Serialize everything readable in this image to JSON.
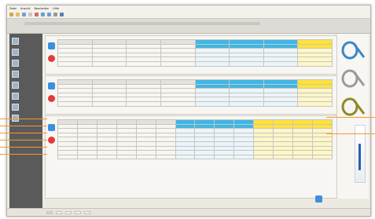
{
  "menu": [
    "Datei",
    "Ansicht",
    "Bearbeiten",
    "Hilfe"
  ],
  "toolbar_icons": [
    "save-icon",
    "open-icon",
    "print-icon",
    "copy-icon",
    "paste-icon",
    "undo-icon",
    "redo-icon",
    "settings-icon",
    "help-icon"
  ],
  "sidebar": {
    "items": [
      "",
      "",
      "",
      "",
      "",
      "",
      "",
      "",
      ""
    ]
  },
  "panels": [
    {
      "title": "",
      "header_grey": [
        "",
        "",
        "",
        ""
      ],
      "header_blue": [
        "",
        "",
        ""
      ],
      "header_yellow": [
        ""
      ],
      "rows": 4
    },
    {
      "title": "",
      "header_grey": [
        "",
        "",
        "",
        ""
      ],
      "header_blue": [
        "",
        "",
        ""
      ],
      "header_yellow": [
        ""
      ],
      "rows": 4
    },
    {
      "title": "",
      "header_grey": [
        "",
        "",
        "",
        "",
        "",
        ""
      ],
      "header_blue": [
        "",
        "",
        "",
        ""
      ],
      "header_yellow": [
        "",
        "",
        "",
        ""
      ],
      "rows": 9
    }
  ],
  "bottom": {
    "label": ""
  },
  "status": {
    "tabs": [
      "",
      "",
      "",
      "",
      ""
    ],
    "right": ""
  },
  "colors": {
    "accent_blue": "#3fb6e6",
    "accent_yellow": "#ffe23a",
    "sidebar": "#5b5a5a",
    "alert_red": "#e23b3b",
    "annotation_orange": "#f29a2e"
  }
}
